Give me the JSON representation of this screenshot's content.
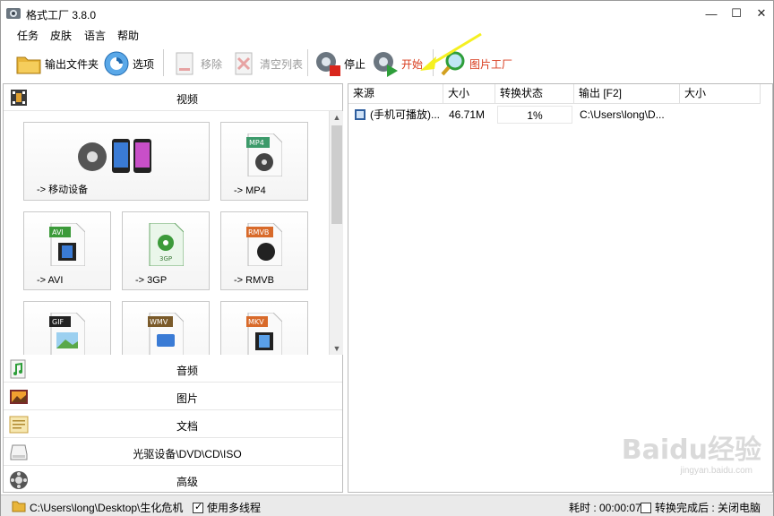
{
  "window": {
    "title": "格式工厂 3.8.0",
    "minimize": "—",
    "maximize": "☐",
    "close": "✕"
  },
  "menu": [
    "任务",
    "皮肤",
    "语言",
    "帮助"
  ],
  "toolbar": {
    "output_folder": "输出文件夹",
    "options": "选项",
    "remove": "移除",
    "clear_list": "清空列表",
    "stop": "停止",
    "start": "开始",
    "picture_factory": "图片工厂"
  },
  "left": {
    "video_header": "视频",
    "tiles": [
      {
        "label": "-> 移动设备",
        "badge": ""
      },
      {
        "label": "-> MP4",
        "badge": "MP4"
      },
      {
        "label": "-> AVI",
        "badge": "AVI"
      },
      {
        "label": "-> 3GP",
        "badge": "3GP"
      },
      {
        "label": "-> RMVB",
        "badge": "RMVB"
      },
      {
        "label": "",
        "badge": "GIF"
      },
      {
        "label": "",
        "badge": "WMV"
      },
      {
        "label": "",
        "badge": "MKV"
      }
    ],
    "categories": [
      "音频",
      "图片",
      "文档",
      "光驱设备\\DVD\\CD\\ISO",
      "高级"
    ]
  },
  "task_list": {
    "headers": [
      "来源",
      "大小",
      "转换状态",
      "输出 [F2]",
      "大小"
    ],
    "rows": [
      {
        "source": "(手机可播放)...",
        "size": "46.71M",
        "status": "1%",
        "output": "C:\\Users\\long\\D...",
        "out_size": ""
      }
    ]
  },
  "statusbar": {
    "path": "C:\\Users\\long\\Desktop\\生化危机",
    "multithread": "使用多线程",
    "elapsed": "耗时 : 00:00:07",
    "after_done": "转换完成后 : 关闭电脑"
  },
  "watermark": {
    "brand": "Baidu经验",
    "url": "jingyan.baidu.com"
  },
  "colors": {
    "accent_red": "#d83b1c",
    "annotation_yellow": "#f5f021"
  }
}
